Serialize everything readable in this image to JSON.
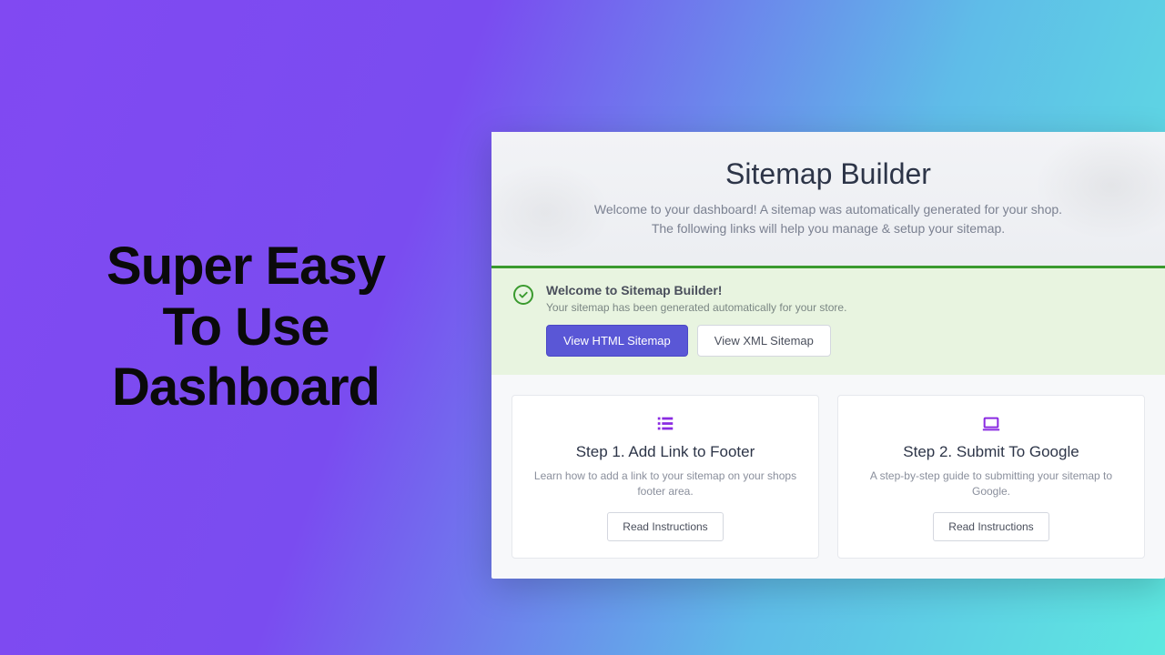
{
  "marketing": {
    "headline_l1": "Super Easy",
    "headline_l2": "To Use",
    "headline_l3": "Dashboard"
  },
  "hero": {
    "title": "Sitemap Builder",
    "subtitle": "Welcome to your dashboard! A sitemap was automatically generated for your shop. The following links will help you manage & setup your sitemap."
  },
  "notice": {
    "title": "Welcome to Sitemap Builder!",
    "message": "Your sitemap has been generated automatically for your store.",
    "btn_primary": "View HTML Sitemap",
    "btn_secondary": "View XML Sitemap"
  },
  "steps": [
    {
      "icon": "list-icon",
      "title": "Step 1. Add Link to Footer",
      "desc": "Learn how to add a link to your sitemap on your shops footer area.",
      "cta": "Read Instructions"
    },
    {
      "icon": "laptop-icon",
      "title": "Step 2. Submit To Google",
      "desc": "A step-by-step guide to submitting your sitemap to Google.",
      "cta": "Read Instructions"
    }
  ]
}
